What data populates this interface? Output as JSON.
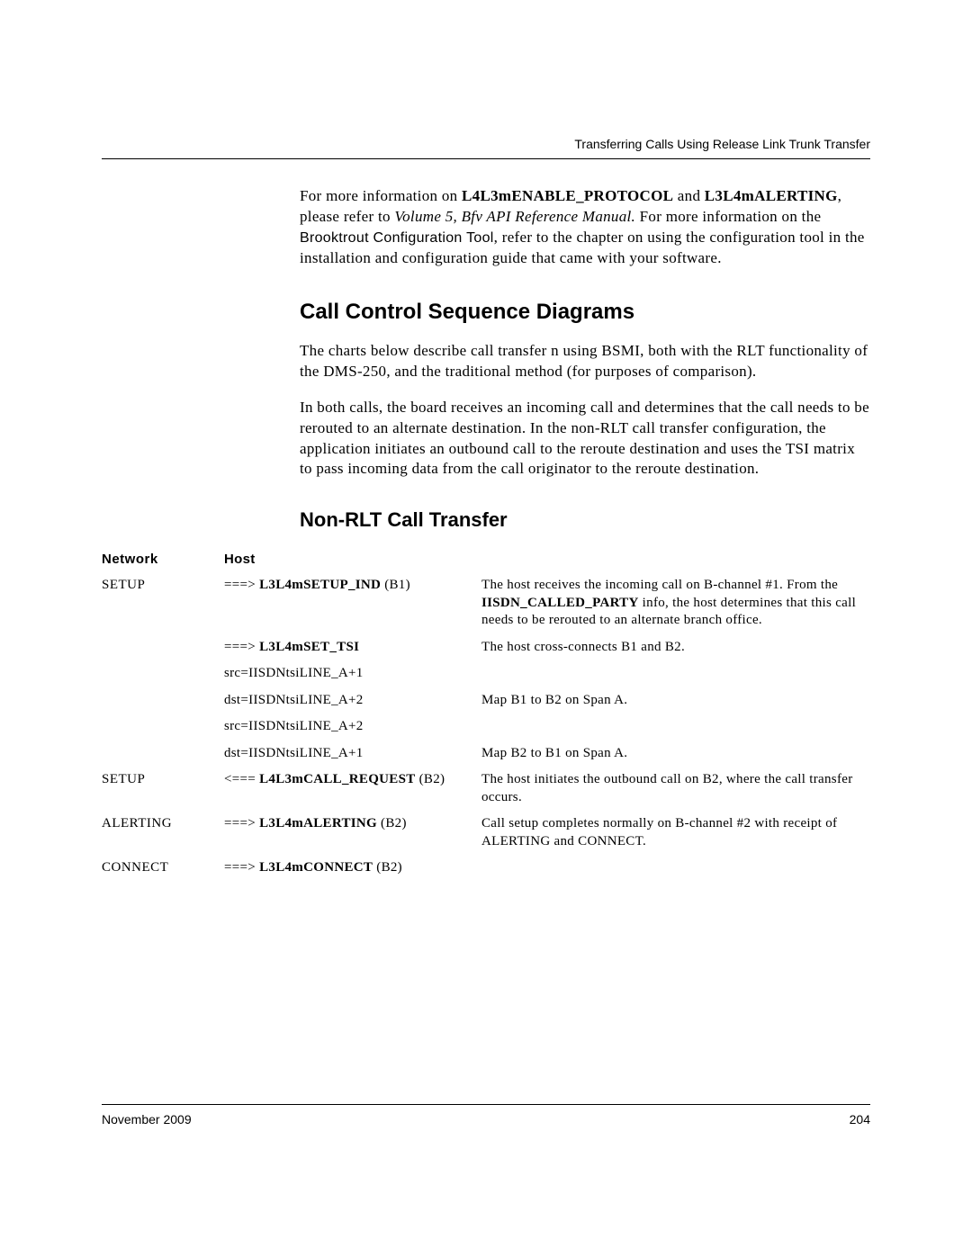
{
  "header": {
    "running_head": "Transferring Calls Using Release Link Trunk Transfer"
  },
  "intro": {
    "pre": "For more information on ",
    "bold1": "L4L3mENABLE_PROTOCOL",
    "mid1": " and ",
    "bold2": "L3L4mALERTING",
    "mid2": ", please refer to ",
    "ital": "Volume 5, Bfv API Reference Manual.",
    "mid3": " For more information on the ",
    "sans": "Brooktrout Configuration Tool",
    "tail": ", refer to the chapter on using the configuration tool in the installation and configuration guide that came with your software."
  },
  "section1": {
    "title": "Call Control Sequence Diagrams",
    "p1": "The charts below describe call transfer n using BSMI, both with the RLT functionality of the DMS-250, and the traditional method (for purposes of comparison).",
    "p2": "In both calls, the board receives an incoming call and determines that the call needs to be rerouted to an alternate destination. In the non-RLT call transfer configuration, the application initiates an outbound call to the reroute destination and uses the TSI matrix to pass incoming data from the call originator to the reroute destination."
  },
  "section2": {
    "title": "Non-RLT Call Transfer",
    "col_net": "Network",
    "col_host": "Host"
  },
  "rows": [
    {
      "net": "SETUP",
      "host_arrow": "===> ",
      "host_bold": "L3L4mSETUP_IND",
      "host_tail": " (B1)",
      "desc_pre": "The host receives the incoming call on B-channel #1. From the ",
      "desc_bold": "IISDN_CALLED_PARTY",
      "desc_post": " info, the host determines that this call needs to be rerouted to an alternate branch office."
    },
    {
      "net": "",
      "host_arrow": "===> ",
      "host_bold": "L3L4mSET_TSI",
      "host_tail": "",
      "desc_pre": "The host cross-connects B1 and B2.",
      "desc_bold": "",
      "desc_post": ""
    },
    {
      "net": "",
      "host_plain": "src=IISDNtsiLINE_A+1",
      "desc_pre": "",
      "desc_bold": "",
      "desc_post": ""
    },
    {
      "net": "",
      "host_plain": "dst=IISDNtsiLINE_A+2",
      "desc_pre": "Map B1 to B2 on Span A.",
      "desc_bold": "",
      "desc_post": ""
    },
    {
      "net": "",
      "host_plain": "src=IISDNtsiLINE_A+2",
      "desc_pre": "",
      "desc_bold": "",
      "desc_post": ""
    },
    {
      "net": "",
      "host_plain": "dst=IISDNtsiLINE_A+1",
      "desc_pre": "Map B2 to B1 on Span A.",
      "desc_bold": "",
      "desc_post": ""
    },
    {
      "net": "SETUP",
      "host_arrow": "<=== ",
      "host_bold": "L4L3mCALL_REQUEST",
      "host_tail": " (B2)",
      "desc_pre": "The host initiates the outbound call on B2, where the call transfer occurs.",
      "desc_bold": "",
      "desc_post": ""
    },
    {
      "net": "ALERTING",
      "host_arrow": "===> ",
      "host_bold": "L3L4mALERTING",
      "host_tail": " (B2)",
      "desc_pre": "Call setup completes normally on B-channel #2 with receipt of ALERTING and CONNECT.",
      "desc_bold": "",
      "desc_post": ""
    },
    {
      "net": "CONNECT",
      "host_arrow": "===> ",
      "host_bold": "L3L4mCONNECT",
      "host_tail": " (B2)",
      "desc_pre": "",
      "desc_bold": "",
      "desc_post": ""
    }
  ],
  "footer": {
    "date": "November 2009",
    "page": "204"
  }
}
